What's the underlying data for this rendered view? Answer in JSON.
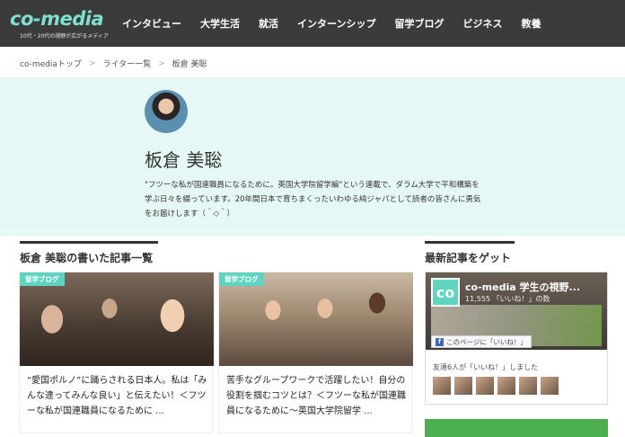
{
  "header": {
    "logo_text": "co-media",
    "logo_tagline": "10代・20代の視野が広がるメディア",
    "nav": [
      "インタビュー",
      "大学生活",
      "就活",
      "インターンシップ",
      "留学ブログ",
      "ビジネス",
      "教養"
    ]
  },
  "breadcrumb": [
    "co-mediaトップ",
    "ライター一覧",
    "板倉 美聡"
  ],
  "profile": {
    "name": "板倉 美聡",
    "bio": "\"フツーな私が国連職員になるために。英国大学院留学編\"という連載で、ダラム大学で平和構築を学ぶ日々を綴っています。20年間日本で育ちまくったいわゆる純ジャパとして読者の皆さんに勇気をお届けします（＾◇＾）"
  },
  "articles_section": {
    "title": "板倉 美聡の書いた記事一覧"
  },
  "articles": [
    {
      "tag": "留学ブログ",
      "title": "“愛国ポルノ”に踊らされる日本人。私は「みんな違ってみんな良い」と伝えたい！＜フツーな私が国連職員になるために ..."
    },
    {
      "tag": "留学ブログ",
      "title": "苦手なグループワークで活躍したい！自分の役割を掴むコツとは？＜フツーな私が国連職員になるために〜英国大学院留学 ..."
    }
  ],
  "sidebar": {
    "title": "最新記事をゲット",
    "fb": {
      "logo": "co",
      "page_name": "co-media 学生の視野...",
      "likes": "11,555 「いいね！」の数",
      "like_button": "このページに「いいね！」",
      "friends": "友達6人が「いいね！」しました"
    }
  }
}
